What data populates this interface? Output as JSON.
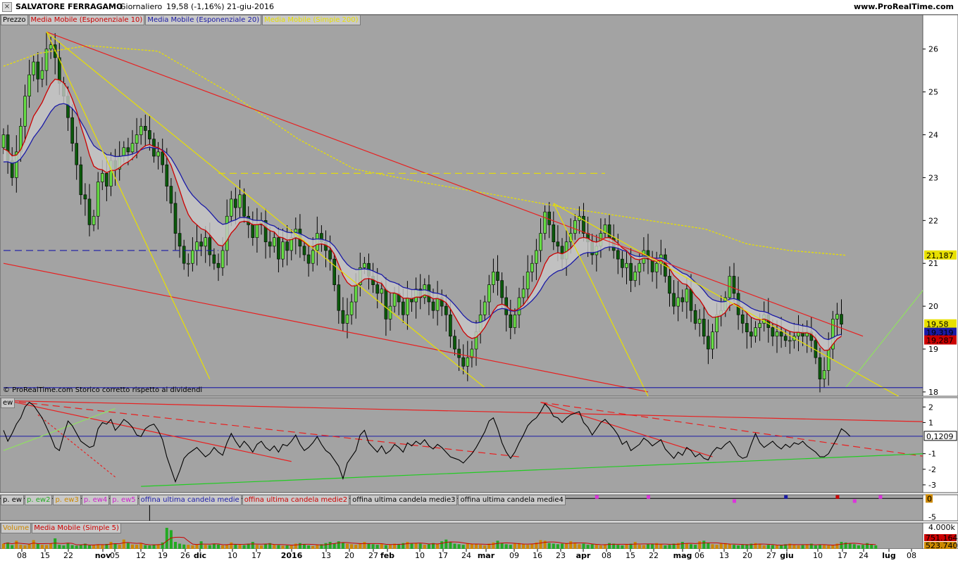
{
  "header": {
    "title": "SALVATORE FERRAGAMO",
    "period": "Giornaliero",
    "last": "19,58 (-1,16%)",
    "date": "21-giu-2016",
    "site": "www.ProRealTime.com"
  },
  "legend_price": [
    {
      "label": "Prezzo",
      "color": "#000000"
    },
    {
      "label": "Media Mobile (Esponenziale 10)",
      "color": "#cc0000"
    },
    {
      "label": "Media Mobile (Esponenziale 20)",
      "color": "#1a1aa6"
    },
    {
      "label": "Media Mobile (Simple 200)",
      "color": "#e8e000"
    }
  ],
  "legend_ew": [
    {
      "label": "ew",
      "color": "#000000"
    }
  ],
  "legend_pew": [
    {
      "label": "p. ew",
      "color": "#000000"
    },
    {
      "label": "p. ew2",
      "color": "#22aa22"
    },
    {
      "label": "p. ew3",
      "color": "#cc8800"
    },
    {
      "label": "p. ew4",
      "color": "#cc22cc"
    },
    {
      "label": "p. ew5",
      "color": "#cc22cc"
    },
    {
      "label": "offina ultima candela medie",
      "color": "#1a1aa6"
    },
    {
      "label": "offina ultima candela medie2",
      "color": "#cc0000"
    },
    {
      "label": "offina ultima candela medie3",
      "color": "#000000"
    },
    {
      "label": "offina ultima candela medie4",
      "color": "#000000"
    }
  ],
  "legend_vol": [
    {
      "label": "Volume",
      "color": "#cc8800"
    },
    {
      "label": "Media Mobile (Simple 5)",
      "color": "#cc0000"
    }
  ],
  "copyright": "© ProRealTime.com  Storico corretto rispetto ai dividendi",
  "colors": {
    "panel_bg": "#a3a3a3",
    "up": "#66dd44",
    "down": "#0a5a0a",
    "ema10": "#cc0000",
    "ema20": "#1a1aa6",
    "sma200": "#e8e000"
  },
  "chart_data": [
    {
      "type": "candlestick",
      "title": "SALVATORE FERRAGAMO",
      "ylim": [
        17.9,
        26.8
      ],
      "y_ticks": [
        "26",
        "25",
        "24",
        "23",
        "22",
        "21",
        "20",
        "19",
        "18"
      ],
      "price_labels": [
        {
          "text": "21,187",
          "value": 21.187,
          "bg": "#e8e000"
        },
        {
          "text": "19,58",
          "value": 19.58,
          "bg": "#e8e000"
        },
        {
          "text": "19,319",
          "value": 19.319,
          "bg": "#1a1aa6"
        },
        {
          "text": "19,287",
          "value": 19.287,
          "bg": "#cc0000"
        }
      ],
      "closes_start": 23.7,
      "closes": [
        24.0,
        23.4,
        23.0,
        23.6,
        24.2,
        24.9,
        25.4,
        25.7,
        25.3,
        25.5,
        26.0,
        26.1,
        25.8,
        25.2,
        24.9,
        24.4,
        23.8,
        23.3,
        22.6,
        22.5,
        21.9,
        22.1,
        22.9,
        23.1,
        22.8,
        23.4,
        23.2,
        23.5,
        23.7,
        23.6,
        23.8,
        24.0,
        24.2,
        24.1,
        23.9,
        23.5,
        23.6,
        23.3,
        22.8,
        22.4,
        21.7,
        21.4,
        21.0,
        21.0,
        21.3,
        21.5,
        21.4,
        21.6,
        21.2,
        21.0,
        20.9,
        21.3,
        22.1,
        22.5,
        22.3,
        22.6,
        22.1,
        21.9,
        21.6,
        21.9,
        22.0,
        21.5,
        21.4,
        21.6,
        21.1,
        21.5,
        21.3,
        21.6,
        21.8,
        21.4,
        21.2,
        21.0,
        21.3,
        21.7,
        21.5,
        21.3,
        21.1,
        20.5,
        19.9,
        19.6,
        19.8,
        20.1,
        20.5,
        20.9,
        21.0,
        20.7,
        20.5,
        20.3,
        20.4,
        19.7,
        20.0,
        20.3,
        20.1,
        19.8,
        20.2,
        20.1,
        20.4,
        20.2,
        20.5,
        20.1,
        19.9,
        20.2,
        20.0,
        19.8,
        19.3,
        19.0,
        18.8,
        18.6,
        18.8,
        19.0,
        19.4,
        19.8,
        20.1,
        20.5,
        20.8,
        20.6,
        20.2,
        19.8,
        19.5,
        19.8,
        20.2,
        20.4,
        20.8,
        21.0,
        21.3,
        21.7,
        22.2,
        21.9,
        21.5,
        21.4,
        21.1,
        21.5,
        21.7,
        22.0,
        22.1,
        21.7,
        21.5,
        21.2,
        21.4,
        21.7,
        21.9,
        21.6,
        21.3,
        21.1,
        20.9,
        21.0,
        20.6,
        20.8,
        21.0,
        21.3,
        21.1,
        20.8,
        21.0,
        21.2,
        20.7,
        20.3,
        20.0,
        20.2,
        20.1,
        20.4,
        19.9,
        19.6,
        19.7,
        19.3,
        19.0,
        19.4,
        19.8,
        19.9,
        20.2,
        20.7,
        20.3,
        19.8,
        19.6,
        19.4,
        19.3,
        19.5,
        19.6,
        19.8,
        19.5,
        19.3,
        19.4,
        19.3,
        19.2,
        19.2,
        19.3,
        19.4,
        19.3,
        19.4,
        19.2,
        18.8,
        18.3,
        18.5,
        19.0,
        19.7,
        19.81,
        19.58
      ],
      "ema10_start": 23.6,
      "ema20_start": 23.3,
      "sma200_points": [
        [
          0,
          25.6
        ],
        [
          25,
          25.9
        ],
        [
          60,
          26.08
        ],
        [
          110,
          25.95
        ],
        [
          160,
          25.0
        ],
        [
          210,
          23.9
        ],
        [
          250,
          23.2
        ],
        [
          300,
          22.88
        ],
        [
          350,
          22.6
        ],
        [
          400,
          22.3
        ],
        [
          450,
          22.05
        ],
        [
          500,
          21.8
        ],
        [
          530,
          21.45
        ],
        [
          560,
          21.3
        ],
        [
          600,
          21.19
        ]
      ],
      "trendlines": [
        {
          "color": "#e82020",
          "from": [
            10,
            26.4
          ],
          "to": [
            200,
            19.3
          ],
          "style": "solid"
        },
        {
          "color": "#e82020",
          "from": [
            0,
            21.0
          ],
          "to": [
            150,
            18.0
          ],
          "style": "solid"
        },
        {
          "color": "#e8e000",
          "from": [
            10,
            26.4
          ],
          "to": [
            48,
            18.3
          ],
          "style": "solid"
        },
        {
          "color": "#e8e000",
          "from": [
            10,
            26.4
          ],
          "to": [
            112,
            18.1
          ],
          "style": "solid"
        },
        {
          "color": "#e8e000",
          "from": [
            128,
            22.4
          ],
          "to": [
            210,
            17.8
          ],
          "style": "solid"
        },
        {
          "color": "#e8e000",
          "from": [
            128,
            22.4
          ],
          "to": [
            150,
            17.9
          ],
          "style": "solid"
        },
        {
          "color": "#90e060",
          "from": [
            196,
            18.1
          ],
          "to": [
            215,
            20.5
          ],
          "style": "solid"
        },
        {
          "color": "#e8e000",
          "from": [
            50,
            23.1
          ],
          "to": [
            140,
            23.1
          ],
          "style": "dashed"
        },
        {
          "color": "#1a1aa6",
          "from": [
            0,
            21.3
          ],
          "to": [
            50,
            21.3
          ],
          "style": "dashed"
        },
        {
          "color": "#1a1aa6",
          "from": [
            0,
            18.1
          ],
          "to": [
            223,
            18.1
          ],
          "style": "solid"
        }
      ]
    },
    {
      "type": "line",
      "series_label": "ew",
      "ylim": [
        -3.5,
        2.6
      ],
      "y_ticks": [
        "2",
        "1",
        "-1",
        "-2",
        "-3"
      ],
      "value_label": {
        "text": "0,1209",
        "value": 0.1209
      },
      "ref_line": 0.12,
      "values": [
        0.5,
        -0.2,
        0.3,
        0.9,
        1.3,
        2.0,
        2.3,
        2.1,
        1.7,
        1.3,
        0.7,
        0.1,
        -0.6,
        -0.8,
        0.2,
        1.1,
        0.8,
        0.3,
        -0.2,
        -0.4,
        -0.6,
        -0.5,
        0.6,
        1.0,
        0.9,
        1.2,
        0.5,
        0.8,
        1.2,
        1.0,
        0.7,
        0.2,
        0.1,
        0.6,
        0.8,
        0.9,
        0.5,
        -0.1,
        -1.2,
        -2.0,
        -2.8,
        -2.1,
        -1.3,
        -1.0,
        -0.8,
        -0.6,
        -0.9,
        -1.2,
        -1.0,
        -0.6,
        -0.9,
        -1.1,
        -0.3,
        0.3,
        -0.2,
        -0.6,
        -0.2,
        -0.5,
        -0.9,
        -0.4,
        -0.2,
        -0.6,
        -0.8,
        -0.5,
        -0.9,
        -0.4,
        -0.5,
        -0.2,
        0.2,
        -0.4,
        -0.8,
        -0.6,
        -0.3,
        0.1,
        -0.4,
        -0.8,
        -1.0,
        -1.4,
        -1.8,
        -2.6,
        -1.6,
        -1.2,
        -0.8,
        0.2,
        0.5,
        -0.3,
        -0.6,
        -0.9,
        -0.5,
        -1.0,
        -0.8,
        -0.4,
        -0.6,
        -0.9,
        -0.3,
        -0.5,
        -0.2,
        -0.4,
        -0.1,
        -0.5,
        -0.7,
        -0.4,
        -0.6,
        -0.9,
        -1.2,
        -1.3,
        -1.4,
        -1.6,
        -1.3,
        -1.0,
        -0.6,
        -0.1,
        0.4,
        1.1,
        1.3,
        0.6,
        -0.3,
        -0.9,
        -1.3,
        -0.9,
        -0.3,
        0.2,
        0.8,
        1.1,
        1.3,
        1.7,
        2.2,
        1.9,
        1.4,
        1.3,
        1.0,
        1.3,
        1.5,
        1.6,
        1.7,
        1.0,
        0.7,
        0.2,
        0.6,
        1.0,
        1.2,
        0.9,
        0.6,
        0.2,
        -0.4,
        -0.2,
        -0.8,
        -0.6,
        -0.4,
        0.0,
        -0.2,
        -0.5,
        -0.3,
        -0.1,
        -0.7,
        -1.0,
        -1.3,
        -0.9,
        -1.1,
        -0.6,
        -0.8,
        -1.2,
        -1.0,
        -1.3,
        -1.4,
        -0.9,
        -0.6,
        -0.7,
        -0.4,
        -0.2,
        -0.6,
        -1.1,
        -1.3,
        -1.2,
        -0.4,
        0.3,
        -0.3,
        -0.6,
        -0.4,
        -0.2,
        -0.5,
        -0.7,
        -0.4,
        -0.6,
        -0.3,
        -0.4,
        -0.2,
        -0.5,
        -0.7,
        -0.9,
        -1.2,
        -1.2,
        -1.0,
        -0.5,
        0.0,
        0.6,
        0.4,
        0.12
      ],
      "trendlines": [
        {
          "color": "#e82020",
          "from": [
            1,
            2.4
          ],
          "to": [
            223,
            1.0
          ],
          "style": "solid"
        },
        {
          "color": "#e82020",
          "from": [
            1,
            2.4
          ],
          "to": [
            67,
            -1.5
          ],
          "style": "solid"
        },
        {
          "color": "#e82020",
          "from": [
            1,
            2.4
          ],
          "to": [
            120,
            -1.2
          ],
          "style": "dashed"
        },
        {
          "color": "#e82020",
          "from": [
            8,
            1.5
          ],
          "to": [
            26,
            -2.5
          ],
          "style": "dotted"
        },
        {
          "color": "#e82020",
          "from": [
            125,
            2.3
          ],
          "to": [
            165,
            -1.2
          ],
          "style": "solid"
        },
        {
          "color": "#e82020",
          "from": [
            125,
            2.3
          ],
          "to": [
            215,
            -1.2
          ],
          "style": "dashed"
        },
        {
          "color": "#90e060",
          "from": [
            0,
            -0.8
          ],
          "to": [
            26,
            1.9
          ],
          "style": "solid"
        },
        {
          "color": "#22cc22",
          "from": [
            32,
            -3.1
          ],
          "to": [
            223,
            -0.9
          ],
          "style": "solid"
        }
      ]
    },
    {
      "type": "line",
      "title": "p. ew",
      "ylim": [
        -6,
        1
      ],
      "y_ticks": [
        "-5"
      ],
      "value_label": {
        "text": "0",
        "value": 0
      },
      "markers": [
        {
          "x": 138,
          "color": "#dd33dd",
          "y": 0.3
        },
        {
          "x": 150,
          "color": "#dd33dd",
          "y": 0.3
        },
        {
          "x": 170,
          "color": "#dd33dd",
          "y": -0.8
        },
        {
          "x": 182,
          "color": "#1a1aa6",
          "y": 0.3
        },
        {
          "x": 194,
          "color": "#cc0000",
          "y": 0.3
        },
        {
          "x": 198,
          "color": "#dd33dd",
          "y": -0.8
        },
        {
          "x": 204,
          "color": "#dd33dd",
          "y": 0.3
        }
      ]
    },
    {
      "type": "bar",
      "title": "Volume",
      "ylim": [
        0,
        4200
      ],
      "y_ticks": [
        "4.000k"
      ],
      "value_labels": [
        {
          "text": "751.164",
          "bg": "#cc0000"
        },
        {
          "text": "523.740",
          "bg": "#cc8800"
        }
      ],
      "values": [
        900,
        1100,
        650,
        1400,
        700,
        600,
        800,
        1500,
        900,
        700,
        650,
        900,
        1800,
        700,
        600,
        1000,
        650,
        550,
        700,
        900,
        600,
        650,
        800,
        700,
        850,
        1200,
        950,
        700,
        1600,
        1000,
        750,
        700,
        900,
        650,
        600,
        700,
        800,
        1100,
        3600,
        3200,
        1200,
        900,
        750,
        700,
        600,
        800,
        1300,
        700,
        650,
        900,
        750,
        600,
        700,
        1100,
        800,
        700,
        650,
        900,
        1200,
        700,
        600,
        800,
        1000,
        700,
        650,
        550,
        600,
        700,
        900,
        1000,
        800,
        600,
        500,
        700,
        800,
        1000,
        1200,
        900,
        1300,
        1100,
        900,
        800,
        700,
        1000,
        1200,
        900,
        800,
        700,
        900,
        650,
        700,
        900,
        800,
        1000,
        1200,
        900,
        1000,
        900,
        700,
        800,
        1000,
        900,
        1300,
        1600,
        1200,
        900,
        800,
        700,
        1000,
        900,
        800,
        700,
        600,
        900,
        1100,
        1400,
        1000,
        800,
        700,
        900,
        1000,
        800,
        700,
        900,
        1100,
        1500,
        1400,
        1000,
        900,
        800,
        900,
        1000,
        1300,
        1100,
        800,
        900,
        700,
        800,
        700,
        600,
        800,
        1000,
        900,
        700,
        600,
        800,
        900,
        1200,
        700,
        650,
        800,
        900,
        1000,
        800,
        600,
        700,
        900,
        1000,
        1200,
        900,
        800,
        700,
        1300,
        1400,
        1000,
        800,
        700,
        900,
        1000,
        800,
        700,
        600,
        700,
        800,
        900,
        1000,
        800,
        600,
        700,
        650,
        600,
        700,
        800,
        900,
        700,
        600,
        650,
        800,
        900,
        600,
        700,
        650,
        600,
        700,
        900,
        1200,
        1100,
        900,
        800,
        600,
        700,
        1000,
        800,
        600
      ]
    }
  ],
  "x_axis": [
    {
      "label": "08",
      "bold": false
    },
    {
      "label": "15",
      "bold": false
    },
    {
      "label": "22",
      "bold": false
    },
    {
      "label": "nov",
      "bold": true
    },
    {
      "label": "05",
      "bold": false
    },
    {
      "label": "12",
      "bold": false
    },
    {
      "label": "19",
      "bold": false
    },
    {
      "label": "26",
      "bold": false
    },
    {
      "label": "dic",
      "bold": true
    },
    {
      "label": "10",
      "bold": false
    },
    {
      "label": "17",
      "bold": false
    },
    {
      "label": "2016",
      "bold": true
    },
    {
      "label": "13",
      "bold": false
    },
    {
      "label": "20",
      "bold": false
    },
    {
      "label": "27",
      "bold": false
    },
    {
      "label": "feb",
      "bold": true
    },
    {
      "label": "10",
      "bold": false
    },
    {
      "label": "17",
      "bold": false
    },
    {
      "label": "24",
      "bold": false
    },
    {
      "label": "mar",
      "bold": true
    },
    {
      "label": "09",
      "bold": false
    },
    {
      "label": "16",
      "bold": false
    },
    {
      "label": "23",
      "bold": false
    },
    {
      "label": "apr",
      "bold": true
    },
    {
      "label": "08",
      "bold": false
    },
    {
      "label": "15",
      "bold": false
    },
    {
      "label": "22",
      "bold": false
    },
    {
      "label": "mag",
      "bold": true
    },
    {
      "label": "06",
      "bold": false
    },
    {
      "label": "13",
      "bold": false
    },
    {
      "label": "20",
      "bold": false
    },
    {
      "label": "27",
      "bold": false
    },
    {
      "label": "giu",
      "bold": true
    },
    {
      "label": "10",
      "bold": false
    },
    {
      "label": "17",
      "bold": false
    },
    {
      "label": "24",
      "bold": false
    },
    {
      "label": "lug",
      "bold": true
    },
    {
      "label": "08",
      "bold": false
    }
  ]
}
